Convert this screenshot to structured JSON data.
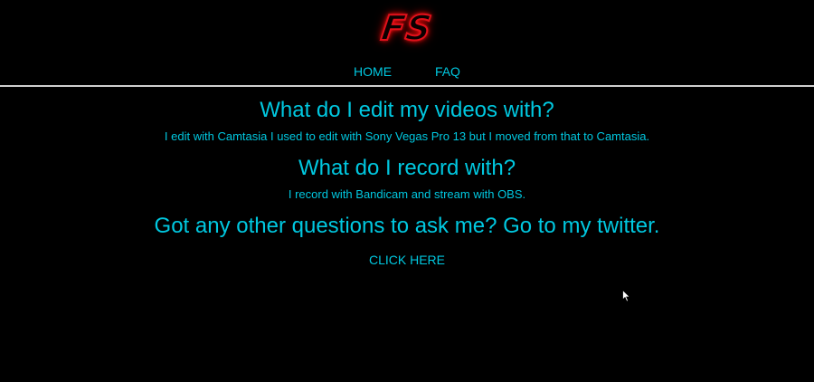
{
  "header": {
    "logo_text": "FS",
    "nav": [
      {
        "label": "HOME"
      },
      {
        "label": "FAQ"
      }
    ]
  },
  "faq": [
    {
      "question": "What do I edit my videos with?",
      "answer": "I edit with Camtasia I used to edit with Sony Vegas Pro 13 but I moved from that to Camtasia."
    },
    {
      "question": "What do I record with?",
      "answer": "I record with Bandicam and stream with OBS."
    }
  ],
  "contact": {
    "heading": "Got any other questions to ask me? Go to my twitter.",
    "link_label": "CLICK HERE"
  },
  "colors": {
    "background": "#000000",
    "text_accent": "#00c8e0",
    "logo_red": "#e0101a",
    "divider": "#cfcfcf"
  },
  "icons": {
    "cursor": "mouse-pointer-icon"
  }
}
